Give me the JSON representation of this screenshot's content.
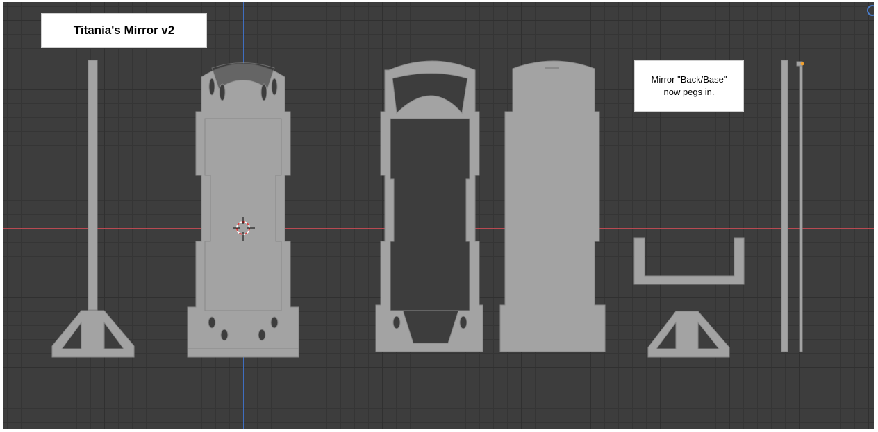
{
  "title": "Titania's Mirror v2",
  "note": {
    "line1": "Mirror \"Back/Base\"",
    "line2": "now pegs in."
  },
  "colors": {
    "background": "#3d3d3d",
    "grid": "#353535",
    "x_axis": "#b84a52",
    "y_axis": "#3f6ec0",
    "model": "#a3a3a3",
    "model_edge": "#8a8a8a"
  },
  "icons": {
    "cursor": "3d-cursor-icon",
    "gizmo": "navigation-gizmo-icon"
  }
}
